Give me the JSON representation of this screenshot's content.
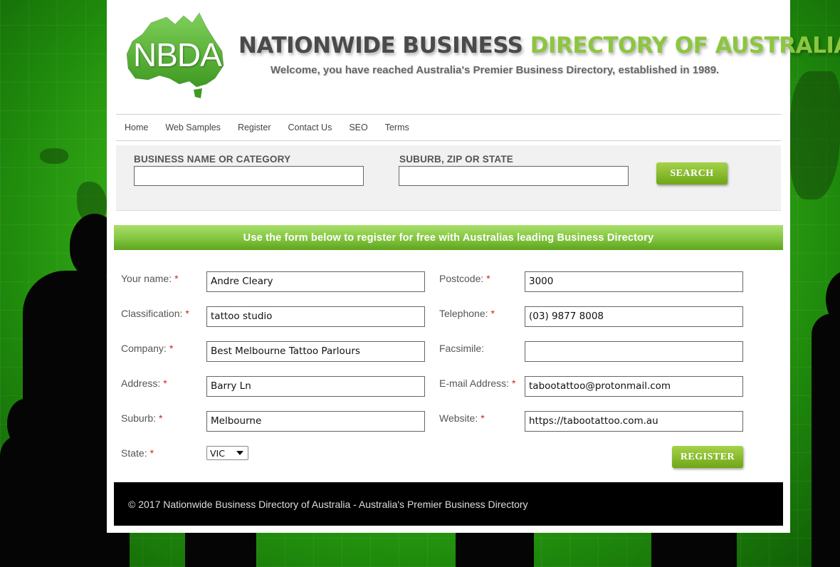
{
  "header": {
    "logo_text": "NBDA",
    "title_dark": "NATIONWIDE BUSINESS",
    "title_green": "DIRECTORY OF AUSTRALIA",
    "tagline": "Welcome, you have reached Australia's Premier Business Directory, established in 1989."
  },
  "nav": {
    "items": [
      "Home",
      "Web Samples",
      "Register",
      "Contact Us",
      "SEO",
      "Terms"
    ]
  },
  "search": {
    "business_label": "BUSINESS NAME OR CATEGORY",
    "business_value": "",
    "location_label": "SUBURB, ZIP OR STATE",
    "location_value": "",
    "button_label": "SEARCH"
  },
  "banner": {
    "text": "Use the form below to register for free with Australias leading Business Directory"
  },
  "form": {
    "left": [
      {
        "label": "Your name:",
        "required": "*",
        "value": "Andre Cleary"
      },
      {
        "label": "Classification:",
        "required": "*",
        "value": "tattoo studio"
      },
      {
        "label": "Company:",
        "required": "*",
        "value": "Best Melbourne Tattoo Parlours"
      },
      {
        "label": "Address:",
        "required": "*",
        "value": "Barry Ln"
      },
      {
        "label": "Suburb:",
        "required": "*",
        "value": "Melbourne"
      }
    ],
    "right": [
      {
        "label": "Postcode:",
        "required": "*",
        "value": "3000"
      },
      {
        "label": "Telephone:",
        "required": "*",
        "value": "(03) 9877 8008"
      },
      {
        "label": "Facsimile:",
        "required": "",
        "value": ""
      },
      {
        "label": "E-mail Address:",
        "required": "*",
        "value": "tabootattoo@protonmail.com"
      },
      {
        "label": "Website:",
        "required": "*",
        "value": "https://tabootattoo.com.au"
      }
    ],
    "state": {
      "label": "State:",
      "required": "*",
      "value": "VIC"
    },
    "register_label": "REGISTER"
  },
  "footer": {
    "text": "© 2017 Nationwide Business Directory of Australia - Australia's Premier Business Directory"
  },
  "colors": {
    "accent_green": "#8cc63f",
    "button_green": "#6fa617",
    "title_dark": "#4a4a4a",
    "required_red": "#d02020",
    "footer_bg": "#000000"
  },
  "icons": {
    "logo": "australia-map-logo",
    "select_arrow": "dropdown-arrow-icon"
  }
}
